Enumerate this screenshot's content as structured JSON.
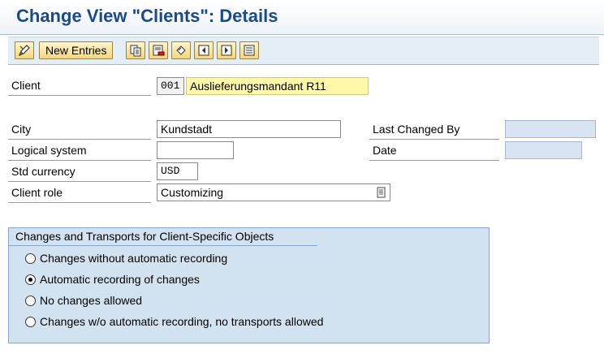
{
  "header": {
    "title": "Change View \"Clients\": Details"
  },
  "toolbar": {
    "new_entries_label": "New Entries",
    "icons": [
      "display-change-icon",
      "copy-icon",
      "delete-icon",
      "undo-icon",
      "previous-entry-icon",
      "next-entry-icon",
      "select-all-icon"
    ]
  },
  "form": {
    "client": {
      "label": "Client",
      "value": "001",
      "description": "Auslieferungsmandant R11"
    },
    "city": {
      "label": "City",
      "value": "Kundstadt"
    },
    "logical_system": {
      "label": "Logical system",
      "value": ""
    },
    "std_currency": {
      "label": "Std currency",
      "value": "USD"
    },
    "client_role": {
      "label": "Client role",
      "value": "Customizing"
    },
    "last_changed_by": {
      "label": "Last Changed By",
      "value": ""
    },
    "date": {
      "label": "Date",
      "value": ""
    }
  },
  "group": {
    "title": "Changes and Transports for Client-Specific Objects",
    "options": [
      {
        "label": "Changes without automatic recording",
        "checked": false
      },
      {
        "label": "Automatic recording of changes",
        "checked": true
      },
      {
        "label": "No changes allowed",
        "checked": false
      },
      {
        "label": "Changes w/o automatic recording, no transports allowed",
        "checked": false
      }
    ]
  },
  "colors": {
    "title": "#1a4a8a",
    "toolbar": "#e4eef7",
    "button": "#f3d77b",
    "group_bg": "#d3e2f0",
    "highlight": "#fff8a8"
  }
}
